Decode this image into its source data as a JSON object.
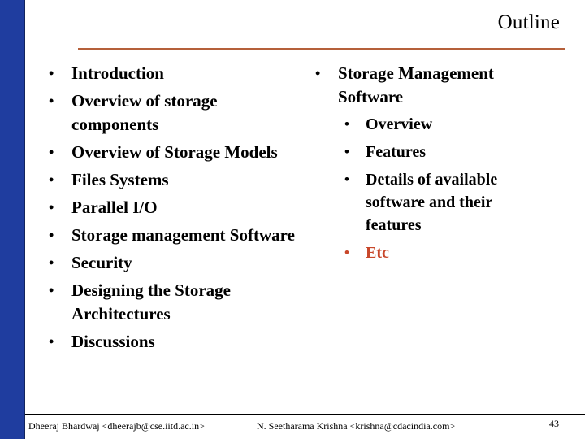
{
  "slide": {
    "title": "Outline",
    "colors": {
      "sidebar": "#1f3d9f",
      "title_rule": "#b5603a",
      "accent_text": "#c8472a"
    },
    "left_bullets": [
      "Introduction",
      "Overview of storage components",
      "Overview of Storage Models",
      "Files Systems",
      "Parallel I/O",
      "Storage management Software",
      "Security",
      "Designing the Storage Architectures",
      "Discussions"
    ],
    "right_bullets": {
      "main": "Storage Management Software",
      "sub": [
        "Overview",
        "Features",
        "Details of available software and their features",
        "Etc"
      ]
    },
    "bullet_glyph": "•"
  },
  "footer": {
    "author_left": "Dheeraj Bhardwaj <dheerajb@cse.iitd.ac.in>",
    "author_center": "N. Seetharama Krishna <krishna@cdacindia.com>",
    "page_number": "43"
  }
}
